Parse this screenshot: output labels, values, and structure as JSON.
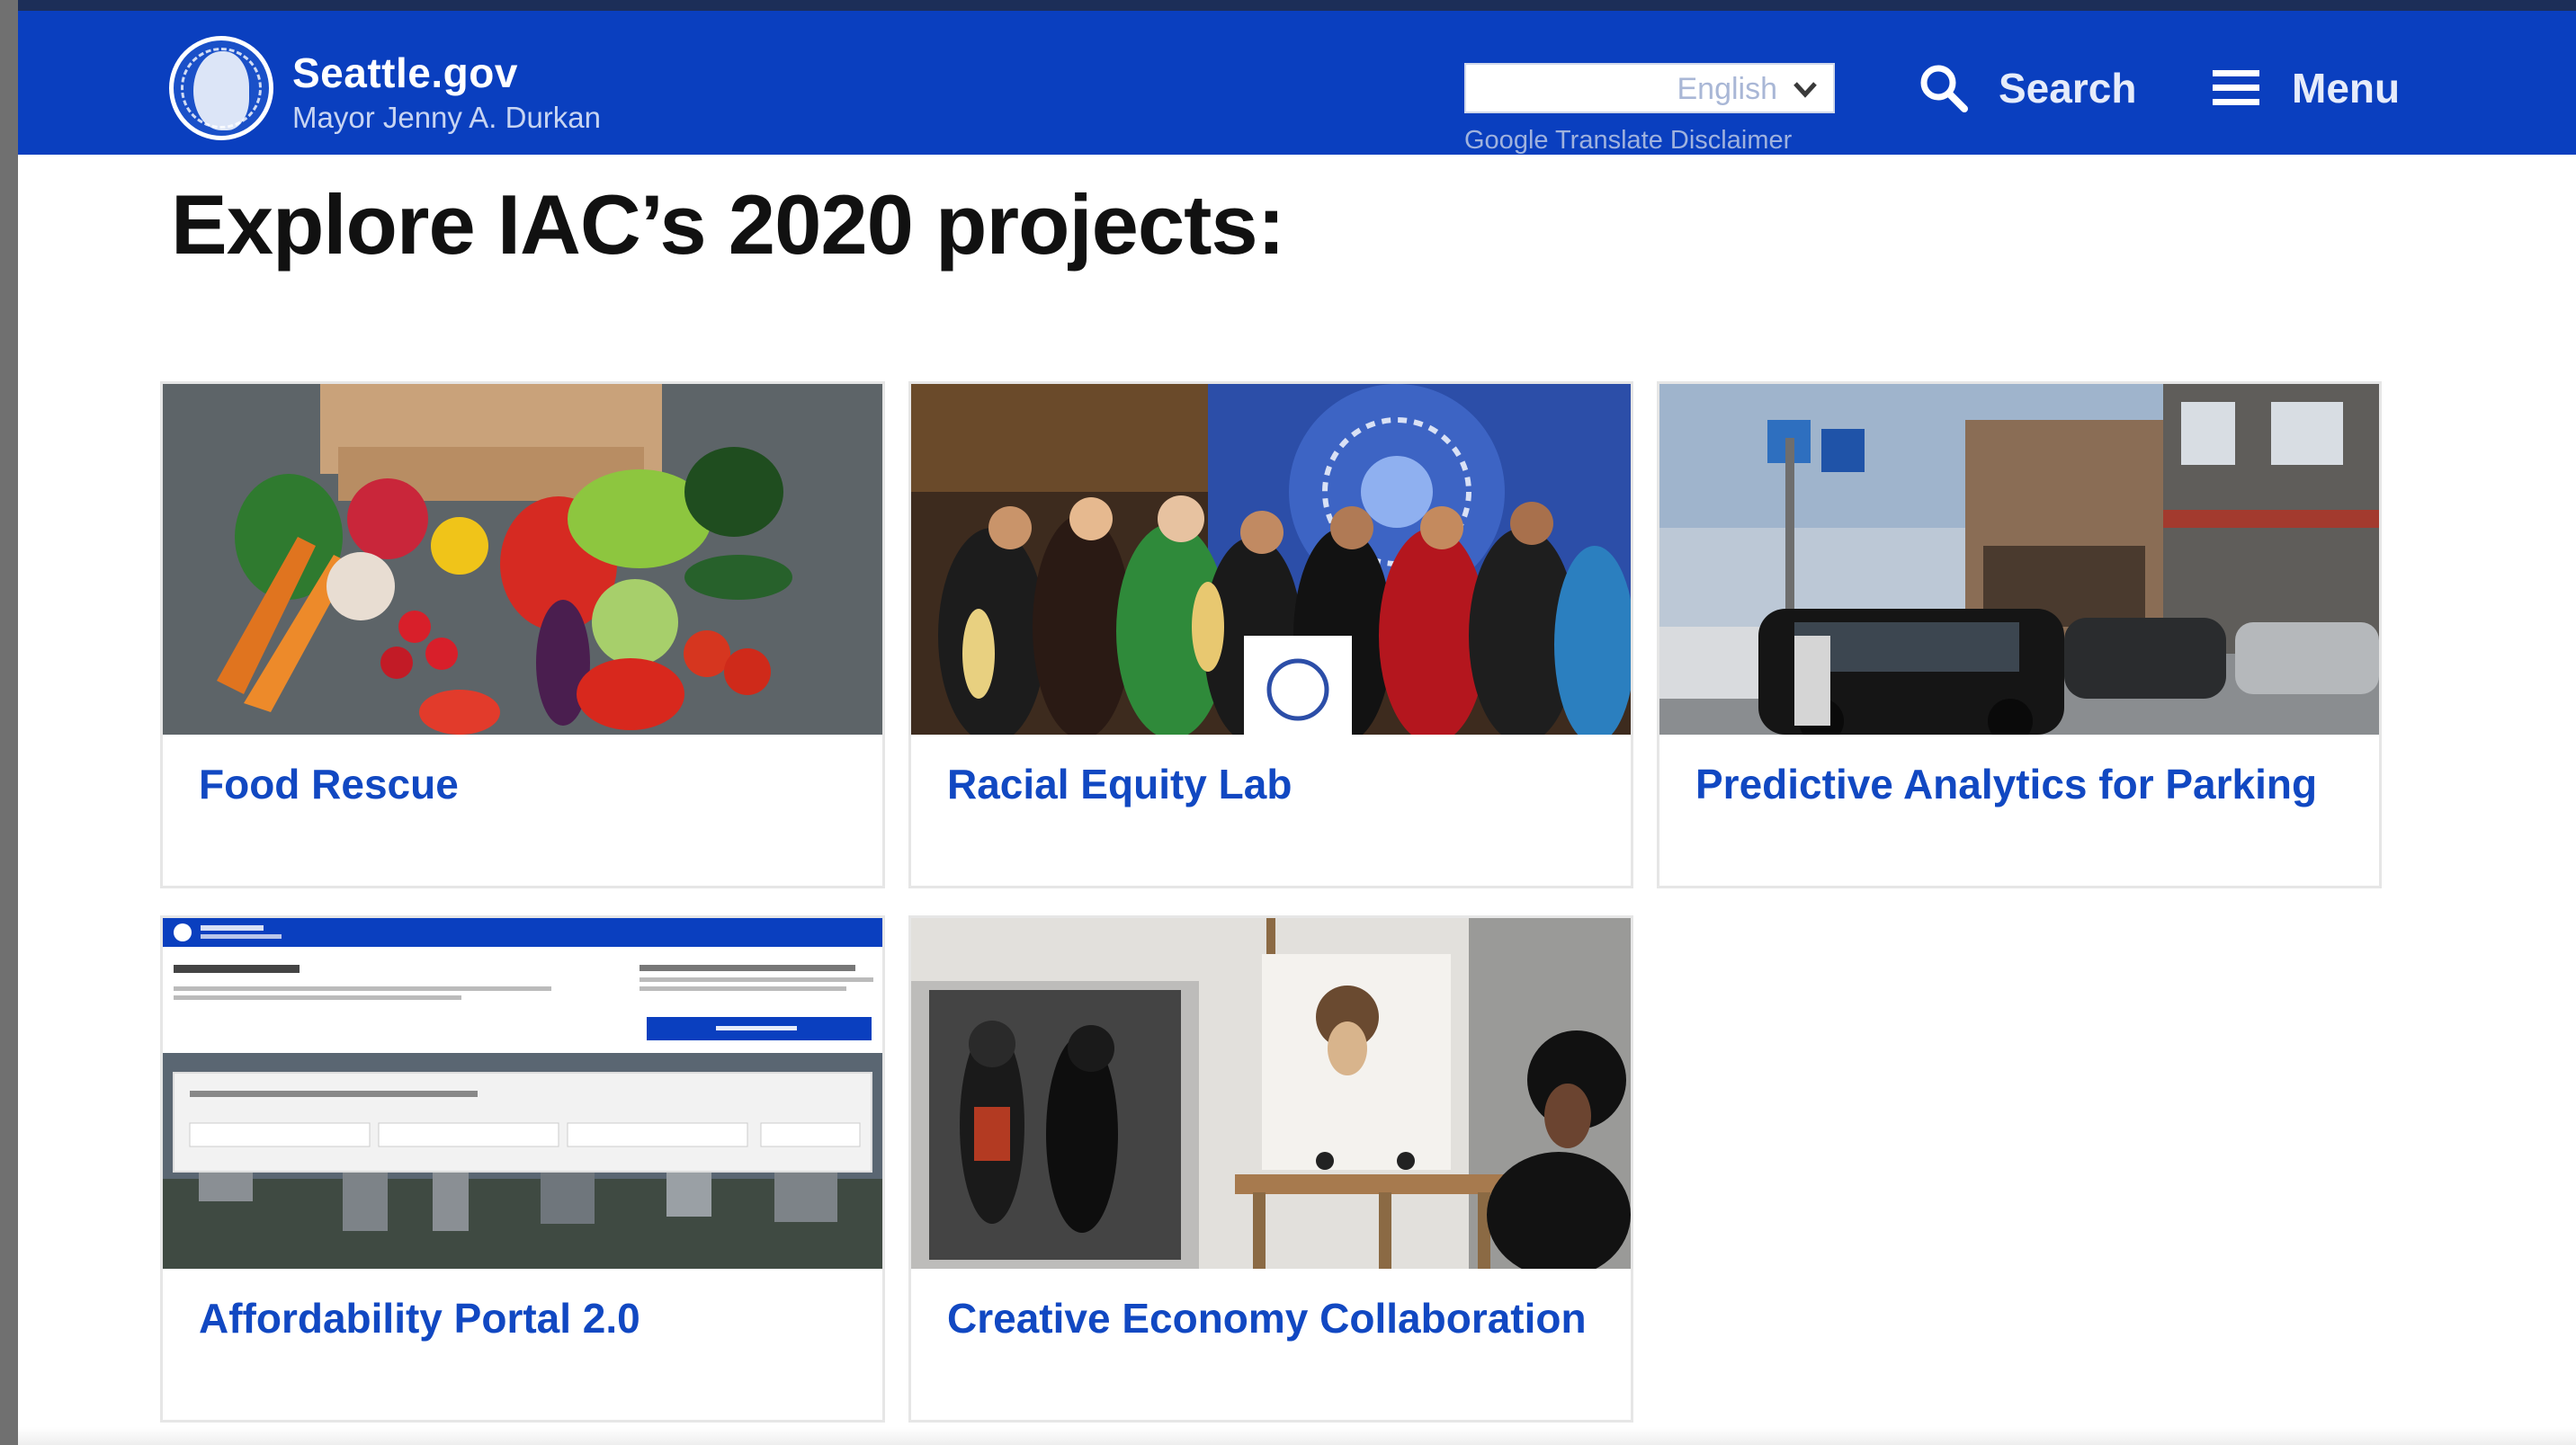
{
  "header": {
    "site_title": "Seattle.gov",
    "subtitle": "Mayor Jenny A. Durkan",
    "logo_icon": "city-seal-icon",
    "language_select": {
      "selected": "English"
    },
    "translate_disclaimer": "Google Translate Disclaimer",
    "search_label": "Search",
    "menu_label": "Menu",
    "colors": {
      "bar": "#0a3fbf",
      "link": "#1148c2"
    }
  },
  "main": {
    "title": "Explore IAC’s 2020 projects:",
    "projects": [
      {
        "title": "Food Rescue",
        "image": "vegetables-photo"
      },
      {
        "title": "Racial Equity Lab",
        "image": "performers-photo"
      },
      {
        "title": "Predictive Analytics for Parking",
        "image": "street-parking-photo"
      },
      {
        "title": "Affordability Portal 2.0",
        "image": "portal-screenshot"
      },
      {
        "title": "Creative Economy Collaboration",
        "image": "art-studio-photo"
      }
    ]
  }
}
